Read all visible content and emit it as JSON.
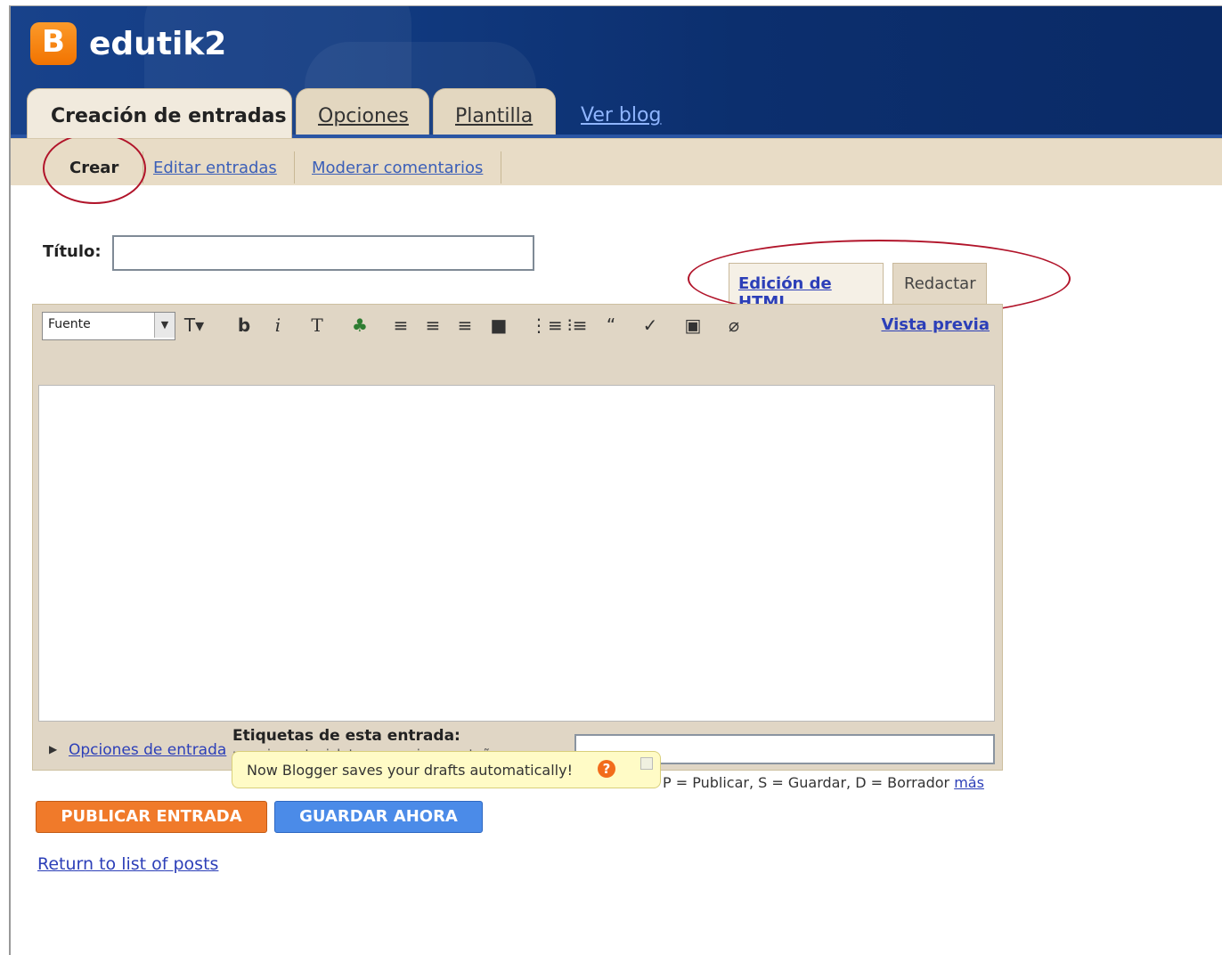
{
  "header": {
    "logo_letter": "B",
    "blog_name": "edutik2",
    "tabs": [
      {
        "label": "Creación de entradas"
      },
      {
        "label": "Opciones"
      },
      {
        "label": "Plantilla"
      }
    ],
    "view_blog": "Ver blog"
  },
  "subnav": {
    "items": [
      {
        "label": "Crear"
      },
      {
        "label": "Editar entradas"
      },
      {
        "label": "Moderar comentarios"
      }
    ]
  },
  "form": {
    "title_label": "Título:",
    "title_value": "",
    "mode_tabs": {
      "html": "Edición de HTML",
      "compose": "Redactar"
    },
    "toolbar": {
      "font_select": "Fuente",
      "icons": [
        "font-size-icon",
        "bold-icon",
        "italic-icon",
        "text-color-icon",
        "link-icon",
        "align-left-icon",
        "align-center-icon",
        "align-right-icon",
        "align-justify-icon",
        "numbered-list-icon",
        "bullet-list-icon",
        "blockquote-icon",
        "spellcheck-icon",
        "image-icon",
        "remove-format-icon"
      ],
      "preview": "Vista previa"
    },
    "body_value": "",
    "post_options": "Opciones de entrada",
    "labels_label": "Etiquetas de esta entrada:",
    "labels_value": "",
    "labels_hint_partial": "por ej.: motocicletas, vacaciones, otoño",
    "tooltip": "Now Blogger saves your drafts automatically!",
    "shortcuts": "P = Publicar, S = Guardar, D = Borrador",
    "shortcuts_more": "más"
  },
  "buttons": {
    "publish": "PUBLICAR ENTRADA",
    "save": "GUARDAR AHORA"
  },
  "return_link": "Return to list of posts"
}
